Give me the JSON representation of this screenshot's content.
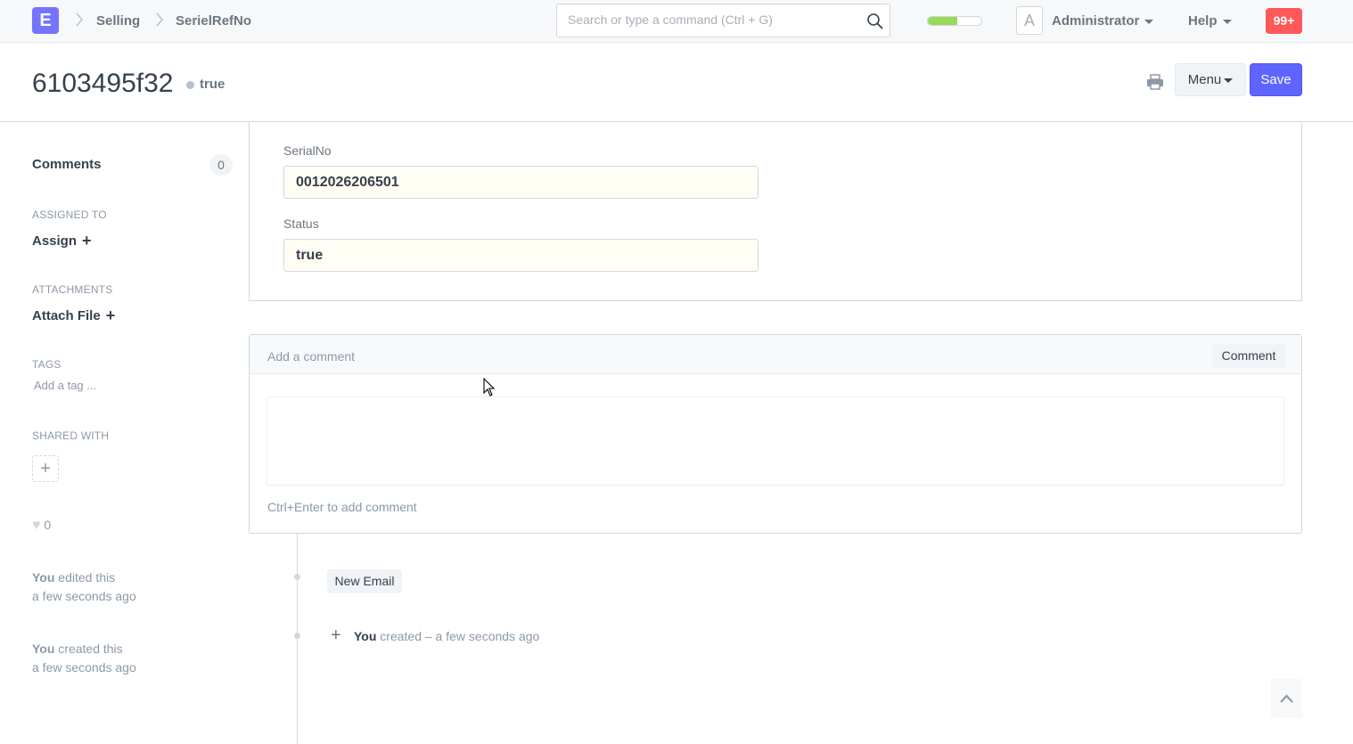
{
  "navbar": {
    "logo_letter": "E",
    "breadcrumbs": [
      "Selling",
      "SerielRefNo"
    ],
    "search_placeholder": "Search or type a command (Ctrl + G)",
    "progress_fraction": 0.55,
    "avatar_letter": "A",
    "user_label": "Administrator",
    "help_label": "Help",
    "notifications": "99+"
  },
  "page_head": {
    "title": "6103495f32",
    "status": "true",
    "menu_label": "Menu",
    "save_label": "Save"
  },
  "sidebar": {
    "comments_label": "Comments",
    "comments_count": "0",
    "assigned_to_label": "ASSIGNED TO",
    "assign_label": "Assign",
    "attachments_label": "ATTACHMENTS",
    "attach_file_label": "Attach File",
    "tags_label": "TAGS",
    "add_tag_label": "Add a tag ...",
    "shared_with_label": "SHARED WITH",
    "likes_count": "0",
    "activity": [
      {
        "who": "You",
        "action": "edited this",
        "when": "a few seconds ago"
      },
      {
        "who": "You",
        "action": "created this",
        "when": "a few seconds ago"
      }
    ]
  },
  "form": {
    "fields": [
      {
        "label": "SerialNo",
        "value": "0012026206501"
      },
      {
        "label": "Status",
        "value": "true"
      }
    ]
  },
  "comment": {
    "placeholder_label": "Add a comment",
    "button_label": "Comment",
    "hint": "Ctrl+Enter to add comment"
  },
  "timeline": {
    "new_email_label": "New Email",
    "entry_who": "You",
    "entry_text": "created – a few seconds ago"
  },
  "colors": {
    "primary": "#5e64ff",
    "logo": "#7574ff",
    "notification": "#ff5858",
    "progress": "#98d85b"
  },
  "icons": [
    "search-icon",
    "chevron-right-icon",
    "printer-icon",
    "plus-icon",
    "heart-icon",
    "chevron-up-icon"
  ]
}
